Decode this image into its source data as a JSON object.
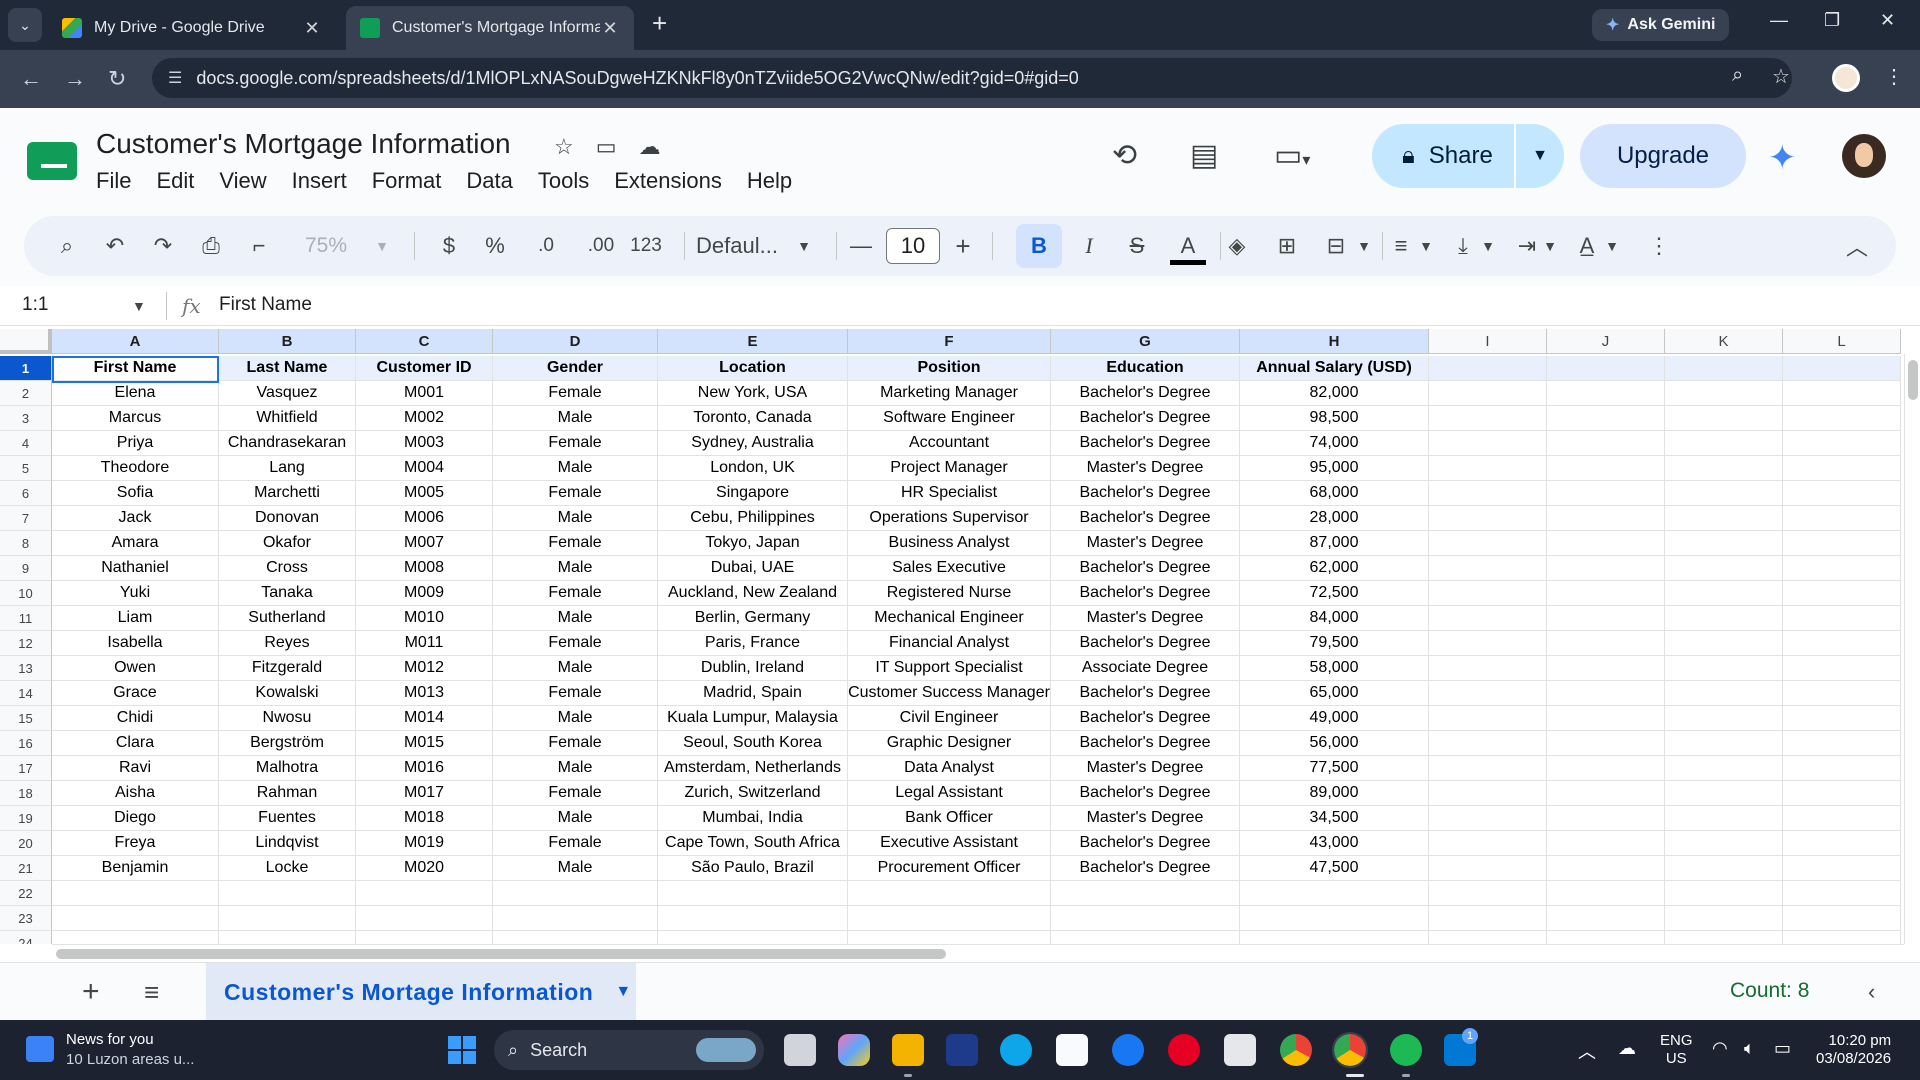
{
  "browser": {
    "tabs": [
      {
        "label": "My Drive - Google Drive",
        "close": "✕"
      },
      {
        "label": "Customer's Mortgage Informat",
        "close": "✕"
      }
    ],
    "new_tab": "+",
    "gemini": "Ask Gemini",
    "url": "docs.google.com/spreadsheets/d/1MlOPLxNASouDgweHZKNkFl8y0nTZviide5OG2VwcQNw/edit?gid=0#gid=0",
    "window_controls": {
      "minimize": "—",
      "restore": "❐",
      "close": "✕"
    }
  },
  "sheets": {
    "title": "Customer's Mortgage Information",
    "menu": [
      "File",
      "Edit",
      "View",
      "Insert",
      "Format",
      "Data",
      "Tools",
      "Extensions",
      "Help"
    ],
    "share_label": "Share",
    "upgrade_label": "Upgrade"
  },
  "toolbar": {
    "zoom": "75%",
    "currency": "$",
    "percent": "%",
    "decrease_decimal": ".0",
    "increase_decimal": ".00",
    "number_format": "123",
    "font": "Defaul...",
    "font_size": "10",
    "minus": "—",
    "plus": "+",
    "bold": "B",
    "italic": "I",
    "strike": "S",
    "text_color": "A",
    "more": "⋮"
  },
  "formula_bar": {
    "name_box": "1:1",
    "fx": "fx",
    "content": "First Name"
  },
  "grid": {
    "columns": [
      "A",
      "B",
      "C",
      "D",
      "E",
      "F",
      "G",
      "H",
      "I",
      "J",
      "K",
      "L"
    ],
    "row_numbers": [
      "1",
      "2",
      "3",
      "4",
      "5",
      "6",
      "7",
      "8",
      "9",
      "10",
      "11",
      "12",
      "13",
      "14",
      "15",
      "16",
      "17",
      "18",
      "19",
      "20",
      "21",
      "22",
      "23",
      "24"
    ],
    "headers": [
      "First Name",
      "Last Name",
      "Customer ID",
      "Gender",
      "Location",
      "Position",
      "Education",
      "Annual Salary (USD)"
    ],
    "rows": [
      [
        "Elena",
        "Vasquez",
        "M001",
        "Female",
        "New York, USA",
        "Marketing Manager",
        "Bachelor's Degree",
        "82,000"
      ],
      [
        "Marcus",
        "Whitfield",
        "M002",
        "Male",
        "Toronto, Canada",
        "Software Engineer",
        "Bachelor's Degree",
        "98,500"
      ],
      [
        "Priya",
        "Chandrasekaran",
        "M003",
        "Female",
        "Sydney, Australia",
        "Accountant",
        "Bachelor's Degree",
        "74,000"
      ],
      [
        "Theodore",
        "Lang",
        "M004",
        "Male",
        "London, UK",
        "Project Manager",
        "Master's Degree",
        "95,000"
      ],
      [
        "Sofia",
        "Marchetti",
        "M005",
        "Female",
        "Singapore",
        "HR Specialist",
        "Bachelor's Degree",
        "68,000"
      ],
      [
        "Jack",
        "Donovan",
        "M006",
        "Male",
        "Cebu, Philippines",
        "Operations Supervisor",
        "Bachelor's Degree",
        "28,000"
      ],
      [
        "Amara",
        "Okafor",
        "M007",
        "Female",
        "Tokyo, Japan",
        "Business Analyst",
        "Master's Degree",
        "87,000"
      ],
      [
        "Nathaniel",
        "Cross",
        "M008",
        "Male",
        "Dubai, UAE",
        "Sales Executive",
        "Bachelor's Degree",
        "62,000"
      ],
      [
        "Yuki",
        "Tanaka",
        "M009",
        "Female",
        "Auckland, New Zealand",
        "Registered Nurse",
        "Bachelor's Degree",
        "72,500"
      ],
      [
        "Liam",
        "Sutherland",
        "M010",
        "Male",
        "Berlin, Germany",
        "Mechanical Engineer",
        "Master's Degree",
        "84,000"
      ],
      [
        "Isabella",
        "Reyes",
        "M011",
        "Female",
        "Paris, France",
        "Financial Analyst",
        "Bachelor's Degree",
        "79,500"
      ],
      [
        "Owen",
        "Fitzgerald",
        "M012",
        "Male",
        "Dublin, Ireland",
        "IT Support Specialist",
        "Associate Degree",
        "58,000"
      ],
      [
        "Grace",
        "Kowalski",
        "M013",
        "Female",
        "Madrid, Spain",
        "Customer Success Manager",
        "Bachelor's Degree",
        "65,000"
      ],
      [
        "Chidi",
        "Nwosu",
        "M014",
        "Male",
        "Kuala Lumpur, Malaysia",
        "Civil Engineer",
        "Bachelor's Degree",
        "49,000"
      ],
      [
        "Clara",
        "Bergström",
        "M015",
        "Female",
        "Seoul, South Korea",
        "Graphic Designer",
        "Bachelor's Degree",
        "56,000"
      ],
      [
        "Ravi",
        "Malhotra",
        "M016",
        "Male",
        "Amsterdam, Netherlands",
        "Data Analyst",
        "Master's Degree",
        "77,500"
      ],
      [
        "Aisha",
        "Rahman",
        "M017",
        "Female",
        "Zurich, Switzerland",
        "Legal Assistant",
        "Bachelor's Degree",
        "89,000"
      ],
      [
        "Diego",
        "Fuentes",
        "M018",
        "Male",
        "Mumbai, India",
        "Bank Officer",
        "Master's Degree",
        "34,500"
      ],
      [
        "Freya",
        "Lindqvist",
        "M019",
        "Female",
        "Cape Town, South Africa",
        "Executive Assistant",
        "Bachelor's Degree",
        "43,000"
      ],
      [
        "Benjamin",
        "Locke",
        "M020",
        "Male",
        "São Paulo, Brazil",
        "Procurement Officer",
        "Bachelor's Degree",
        "47,500"
      ]
    ]
  },
  "sheet_tabs": {
    "add": "+",
    "all": "≡",
    "active": "Customer's Mortage Information",
    "count": "Count: 8"
  },
  "taskbar": {
    "news_title": "News for you",
    "news_sub": "10 Luzon areas u...",
    "search": "Search",
    "lang_top": "ENG",
    "lang_bottom": "US",
    "time": "10:20 pm",
    "date": "03/08/2026",
    "badge": "1"
  },
  "colors": {
    "accent": "#0b57d0",
    "header_fill": "#e8f0fe",
    "selection": "#1a73e8",
    "share": "#c2e7ff",
    "count_green": "#146c2e"
  }
}
